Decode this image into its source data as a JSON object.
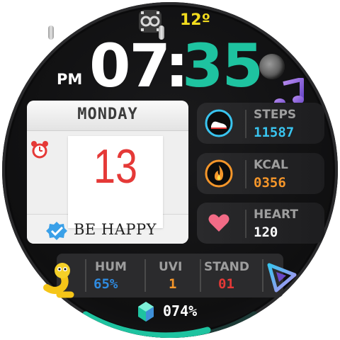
{
  "header": {
    "temperature": "12º"
  },
  "clock": {
    "ampm": "PM",
    "hours": "07",
    "separator": ":",
    "minutes": "35"
  },
  "calendar": {
    "weekday": "MONDAY",
    "day": "13",
    "message": "BE HAPPY"
  },
  "stats": {
    "steps": {
      "label": "STEPS",
      "value": "11587"
    },
    "kcal": {
      "label": "KCAL",
      "value": "0356"
    },
    "heart": {
      "label": "HEART",
      "value": "120"
    }
  },
  "bottom": {
    "humidity": {
      "label": "HUM",
      "value": "65%"
    },
    "uvi": {
      "label": "UVI",
      "value": "1"
    },
    "stand": {
      "label": "STAND",
      "value": "01"
    },
    "battery": {
      "value": "074%"
    }
  },
  "icons": [
    "link-icon",
    "moon-icon",
    "music-note-icon",
    "alarm-icon",
    "verified-badge-icon",
    "shoe-icon",
    "flame-icon",
    "heart-icon",
    "worm-icon",
    "triangle-icon",
    "battery-crystal-icon"
  ],
  "colors": {
    "minutes": "#1ec3a0",
    "temperature": "#f2dc1e",
    "steps": "#39c4ef",
    "kcal": "#f5962a",
    "heart": "#ffffff",
    "humidity": "#2f8be0",
    "uvi": "#f5962a",
    "stand": "#e53937",
    "arc": "#1ec3a0"
  }
}
